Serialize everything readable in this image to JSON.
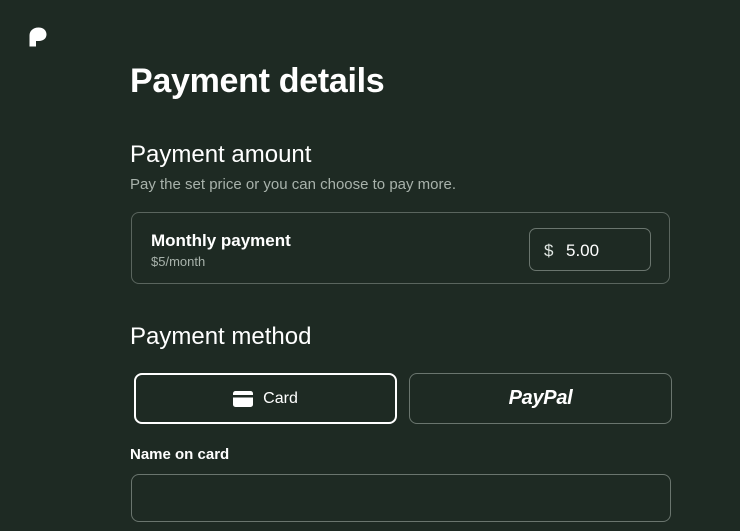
{
  "brand": {
    "logo_icon": "patreon-logo-icon"
  },
  "page": {
    "title": "Payment details"
  },
  "payment_amount": {
    "title": "Payment amount",
    "subtitle": "Pay the set price or you can choose to pay more.",
    "option_label": "Monthly payment",
    "option_price": "$5/month",
    "currency_symbol": "$",
    "amount_value": "5.00"
  },
  "payment_method": {
    "title": "Payment method",
    "card_label": "Card",
    "card_icon": "credit-card-icon",
    "paypal_label": "PayPal",
    "selected": "Card"
  },
  "card_form": {
    "name_label": "Name on card",
    "name_value": ""
  },
  "colors": {
    "background": "#1e2a23",
    "text": "#ffffff",
    "muted_text": "#a8b2ab",
    "border": "#6a756e"
  }
}
